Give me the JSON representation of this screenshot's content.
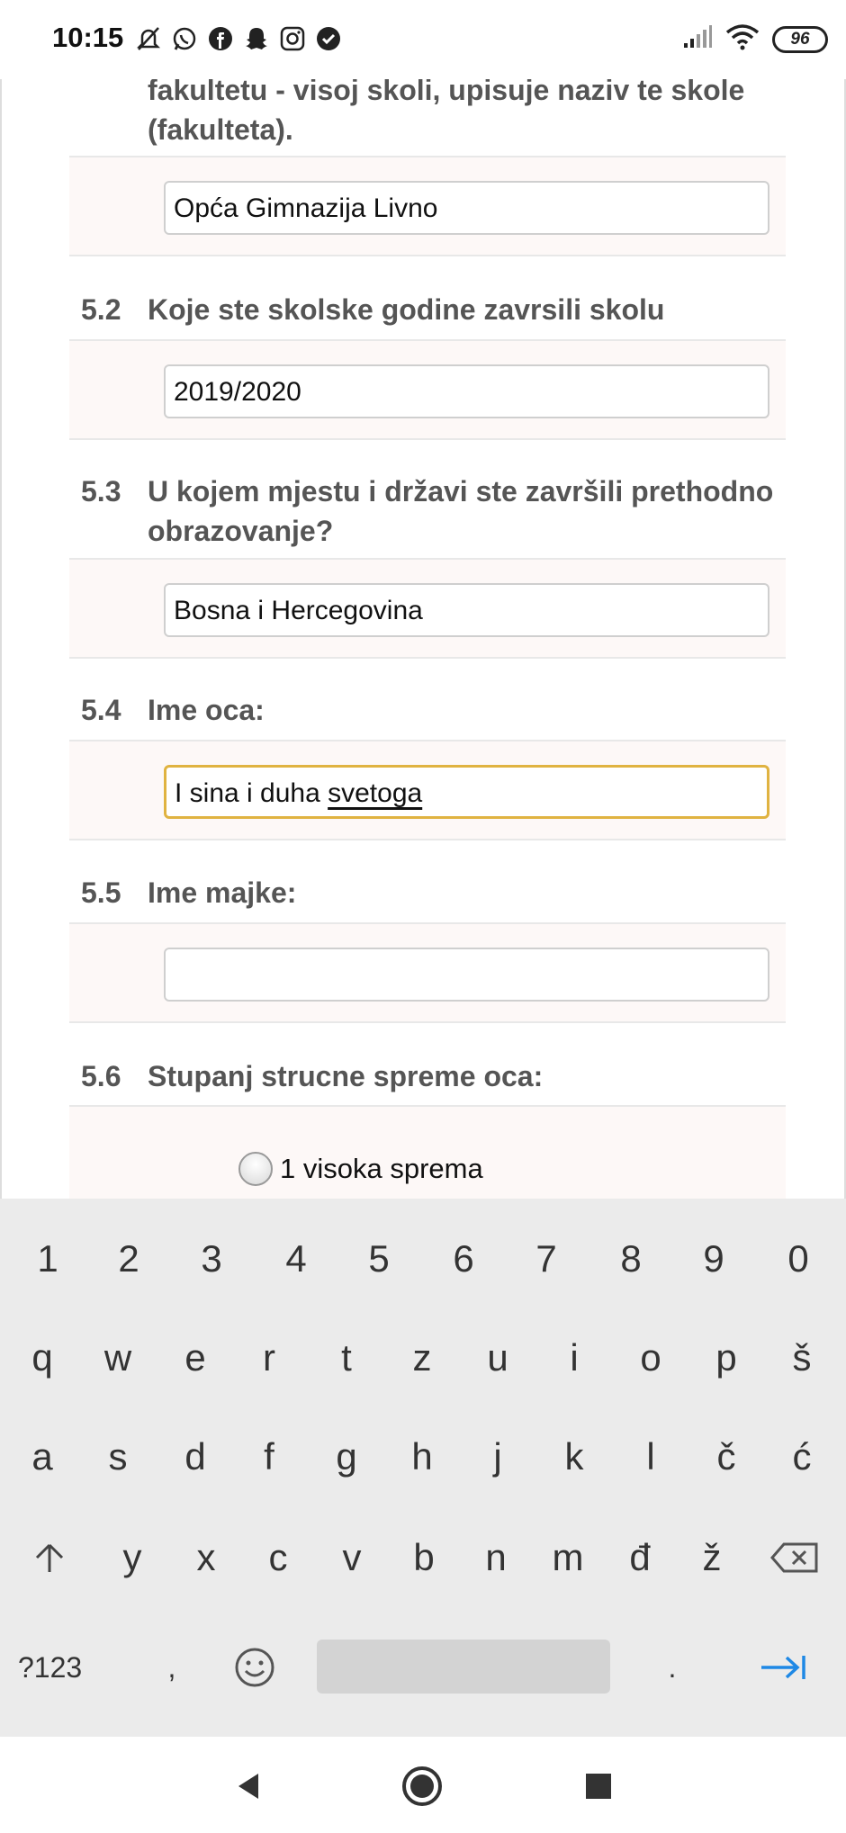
{
  "status_bar": {
    "time": "10:15",
    "battery": "96"
  },
  "form": {
    "q51_tail": "fakultetu - visoj skoli, upisuje naziv te skole (fakulteta).",
    "q51_value": "Opća Gimnazija Livno",
    "questions": [
      {
        "num": "5.2",
        "text": "Koje ste skolske godine zavrsili skolu",
        "value": "2019/2020"
      },
      {
        "num": "5.3",
        "text": "U kojem mjestu i državi ste završili prethodno obrazovanje?",
        "value": "Bosna i Hercegovina"
      },
      {
        "num": "5.4",
        "text": "Ime oca:",
        "value_plain": "I sina i duha ",
        "value_underlined": "svetoga"
      },
      {
        "num": "5.5",
        "text": "Ime majke:",
        "value": ""
      },
      {
        "num": "5.6",
        "text": "Stupanj strucne spreme oca:"
      }
    ],
    "radio_option_1": "1 visoka sprema"
  },
  "keyboard": {
    "row_numbers": [
      "1",
      "2",
      "3",
      "4",
      "5",
      "6",
      "7",
      "8",
      "9",
      "0"
    ],
    "row1": [
      "q",
      "w",
      "e",
      "r",
      "t",
      "z",
      "u",
      "i",
      "o",
      "p",
      "š"
    ],
    "row2": [
      "a",
      "s",
      "d",
      "f",
      "g",
      "h",
      "j",
      "k",
      "l",
      "č",
      "ć"
    ],
    "row3": [
      "y",
      "x",
      "c",
      "v",
      "b",
      "n",
      "m",
      "đ",
      "ž"
    ],
    "symbols_key": "?123",
    "comma_key": ",",
    "period_key": "."
  },
  "colors": {
    "focus_border": "#e0b341",
    "tab_arrow": "#1e88e5"
  }
}
